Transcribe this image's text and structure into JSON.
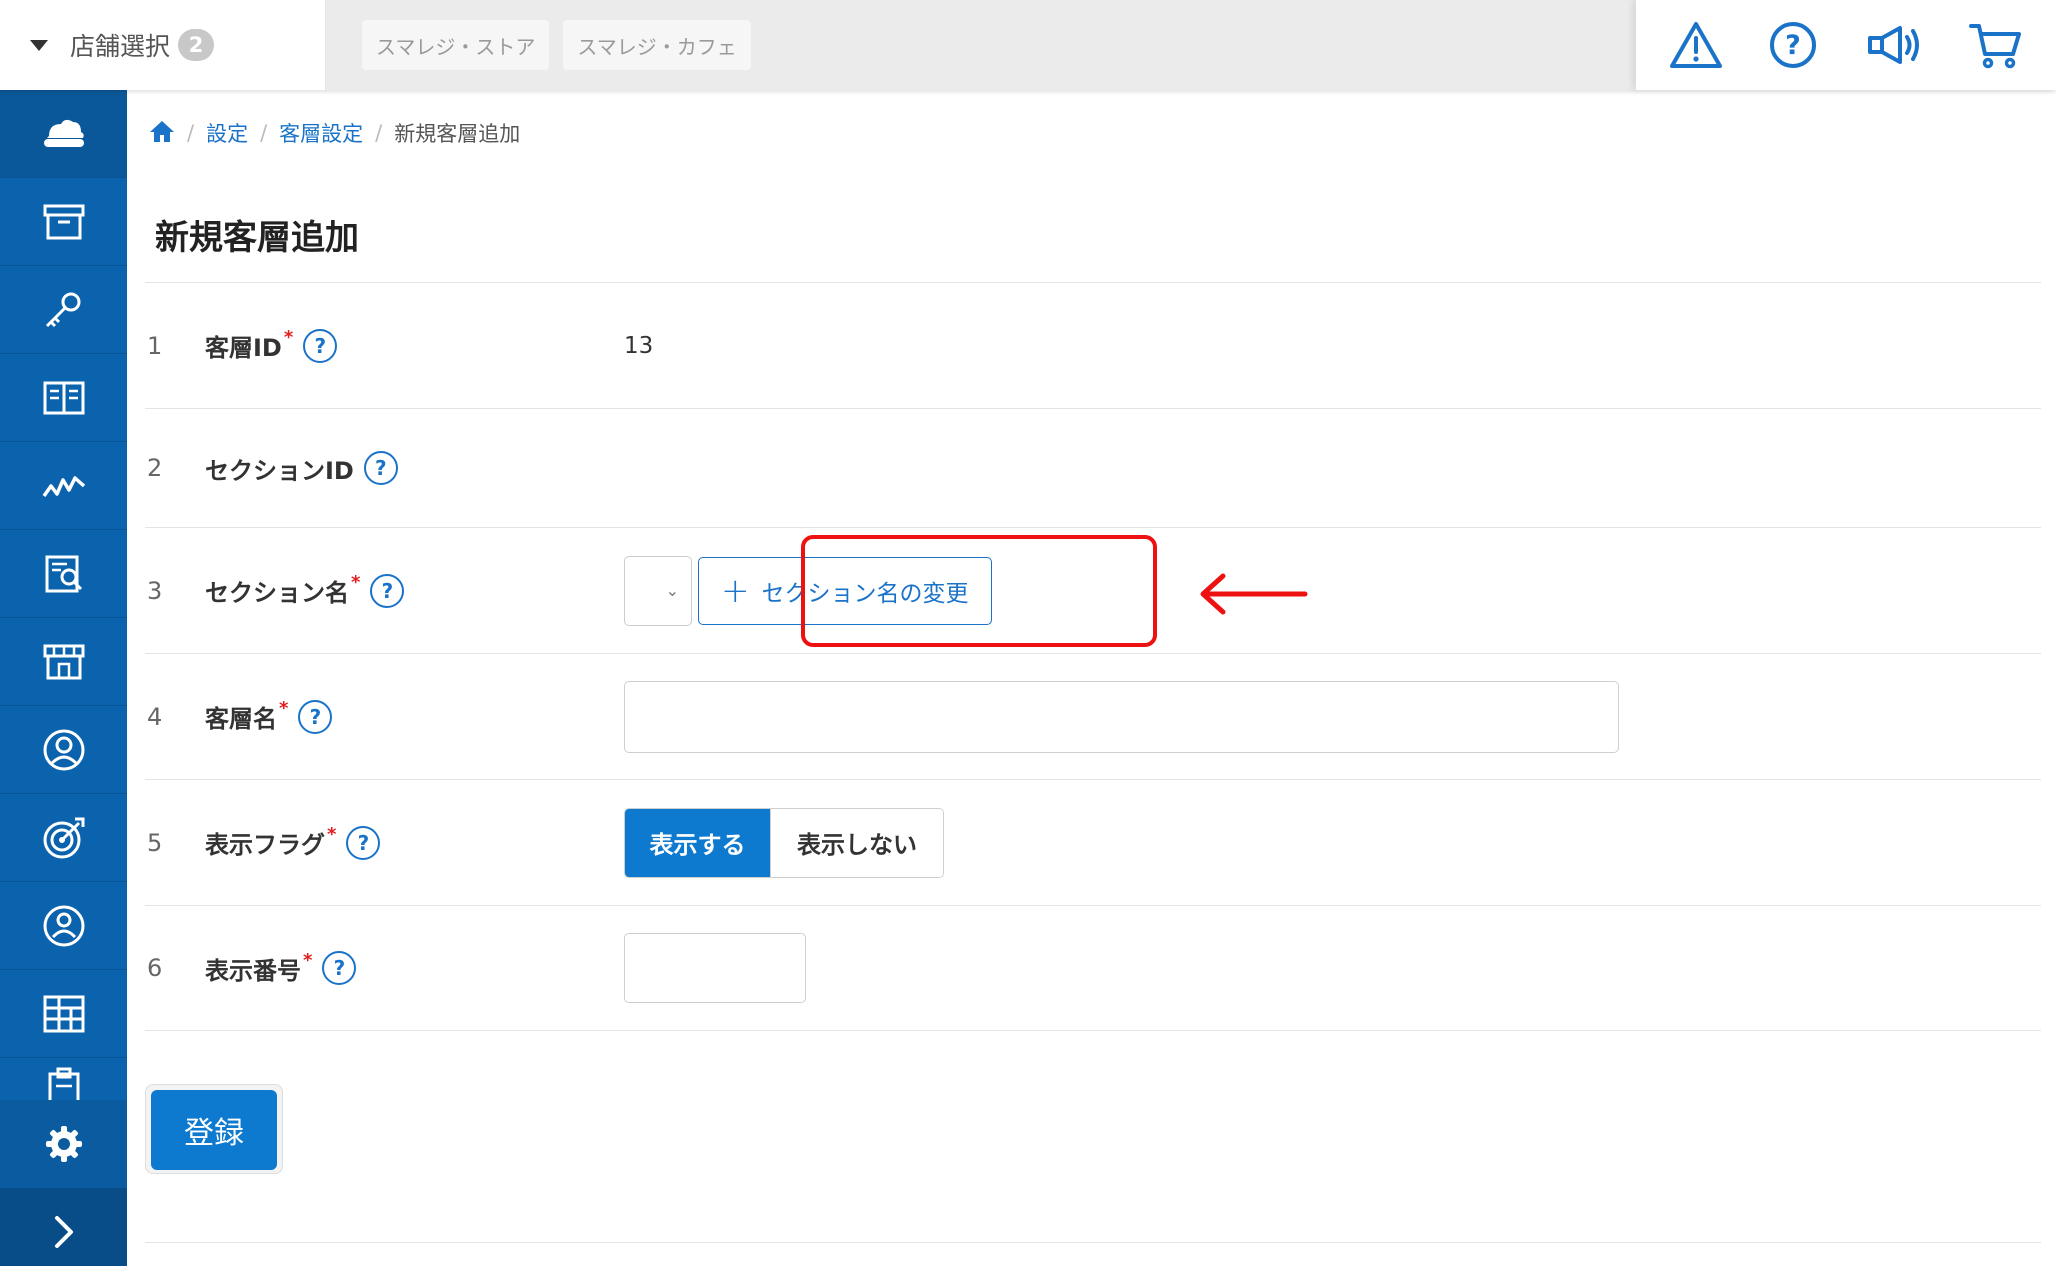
{
  "topbar": {
    "store_select_label": "店舗選択",
    "store_count": "2",
    "store_tabs": [
      "スマレジ・ストア",
      "スマレジ・カフェ"
    ],
    "icons": [
      "warning-icon",
      "help-icon",
      "megaphone-icon",
      "cart-icon"
    ]
  },
  "sidebar": {
    "items": [
      "cloud-icon",
      "archive-icon",
      "key-icon",
      "book-icon",
      "chart-icon",
      "report-search-icon",
      "store-icon",
      "user-circle-icon",
      "target-icon",
      "customer-icon",
      "grid-icon",
      "clipboard-icon"
    ],
    "settings_icon": "gear-icon",
    "expand_icon": "chevron-right-icon"
  },
  "breadcrumb": {
    "home_icon": "home-icon",
    "items": [
      "設定",
      "客層設定"
    ],
    "current": "新規客層追加"
  },
  "page": {
    "title": "新規客層追加"
  },
  "form": {
    "rows": [
      {
        "num": "1",
        "label": "客層ID",
        "required": "*",
        "value": "13"
      },
      {
        "num": "2",
        "label": "セクションID",
        "required": ""
      },
      {
        "num": "3",
        "label": "セクション名",
        "required": "*",
        "button_label": "セクション名の変更"
      },
      {
        "num": "4",
        "label": "客層名",
        "required": "*"
      },
      {
        "num": "5",
        "label": "表示フラグ",
        "required": "*",
        "options": [
          "表示する",
          "表示しない"
        ],
        "selected": "表示する"
      },
      {
        "num": "6",
        "label": "表示番号",
        "required": "*"
      }
    ],
    "help_mark": "?",
    "submit_label": "登録"
  },
  "colors": {
    "sidebar": "#0b63ad",
    "accent": "#0d79cf",
    "link": "#1a73c8",
    "highlight": "#ee1111"
  }
}
